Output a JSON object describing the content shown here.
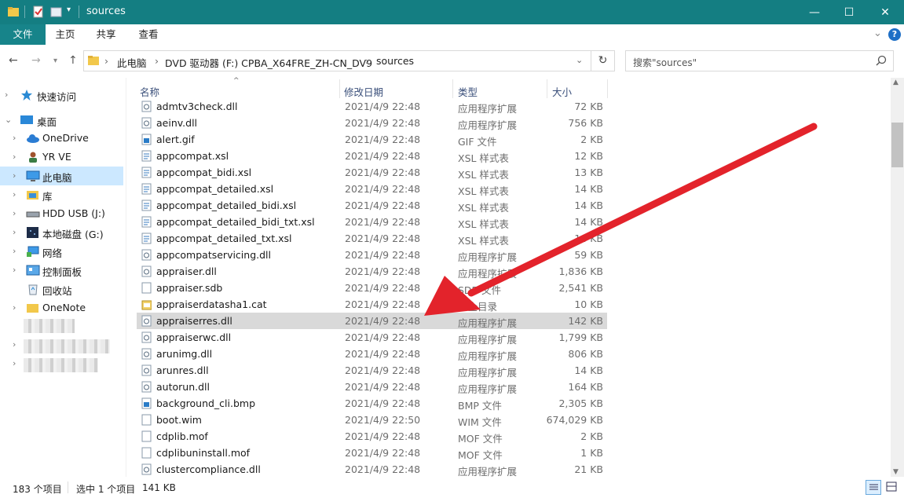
{
  "window": {
    "title": "sources",
    "minimize": "—",
    "maximize": "☐",
    "close": "✕"
  },
  "ribbon": {
    "tabs": [
      "文件",
      "主页",
      "共享",
      "查看"
    ],
    "collapse": "⌄",
    "help": "?"
  },
  "address": {
    "crumbs": [
      "此电脑",
      "DVD 驱动器 (F:) CPBA_X64FRE_ZH-CN_DV9",
      "sources"
    ],
    "search_placeholder": "搜索\"sources\""
  },
  "nav": {
    "items": [
      {
        "label": "快速访问",
        "icon": "star-icon"
      },
      {
        "label": "桌面",
        "icon": "desktop-icon"
      },
      {
        "label": "OneDrive",
        "icon": "cloud-icon"
      },
      {
        "label": "YR VE",
        "icon": "user-icon"
      },
      {
        "label": "此电脑",
        "icon": "computer-icon",
        "selected": true
      },
      {
        "label": "库",
        "icon": "library-icon"
      },
      {
        "label": "HDD USB (J:)",
        "icon": "drive-icon"
      },
      {
        "label": "本地磁盘 (G:)",
        "icon": "disk-icon"
      },
      {
        "label": "网络",
        "icon": "network-icon"
      },
      {
        "label": "控制面板",
        "icon": "control-panel-icon"
      },
      {
        "label": "回收站",
        "icon": "recycle-bin-icon"
      },
      {
        "label": "OneNote",
        "icon": "folder-icon"
      }
    ]
  },
  "columns": {
    "name": "名称",
    "date": "修改日期",
    "type": "类型",
    "size": "大小"
  },
  "files": [
    {
      "name": "admtv3check.dll",
      "date": "2021/4/9 22:48",
      "type": "应用程序扩展",
      "size": "72 KB",
      "icon": "dll"
    },
    {
      "name": "aeinv.dll",
      "date": "2021/4/9 22:48",
      "type": "应用程序扩展",
      "size": "756 KB",
      "icon": "dll"
    },
    {
      "name": "alert.gif",
      "date": "2021/4/9 22:48",
      "type": "GIF 文件",
      "size": "2 KB",
      "icon": "img"
    },
    {
      "name": "appcompat.xsl",
      "date": "2021/4/9 22:48",
      "type": "XSL 样式表",
      "size": "12 KB",
      "icon": "xsl"
    },
    {
      "name": "appcompat_bidi.xsl",
      "date": "2021/4/9 22:48",
      "type": "XSL 样式表",
      "size": "13 KB",
      "icon": "xsl"
    },
    {
      "name": "appcompat_detailed.xsl",
      "date": "2021/4/9 22:48",
      "type": "XSL 样式表",
      "size": "14 KB",
      "icon": "xsl"
    },
    {
      "name": "appcompat_detailed_bidi.xsl",
      "date": "2021/4/9 22:48",
      "type": "XSL 样式表",
      "size": "14 KB",
      "icon": "xsl"
    },
    {
      "name": "appcompat_detailed_bidi_txt.xsl",
      "date": "2021/4/9 22:48",
      "type": "XSL 样式表",
      "size": "14 KB",
      "icon": "xsl"
    },
    {
      "name": "appcompat_detailed_txt.xsl",
      "date": "2021/4/9 22:48",
      "type": "XSL 样式表",
      "size": "14 KB",
      "icon": "xsl"
    },
    {
      "name": "appcompatservicing.dll",
      "date": "2021/4/9 22:48",
      "type": "应用程序扩展",
      "size": "59 KB",
      "icon": "dll"
    },
    {
      "name": "appraiser.dll",
      "date": "2021/4/9 22:48",
      "type": "应用程序扩展",
      "size": "1,836 KB",
      "icon": "dll"
    },
    {
      "name": "appraiser.sdb",
      "date": "2021/4/9 22:48",
      "type": "SDB 文件",
      "size": "2,541 KB",
      "icon": "file"
    },
    {
      "name": "appraiserdatasha1.cat",
      "date": "2021/4/9 22:48",
      "type": "安全目录",
      "size": "10 KB",
      "icon": "cat"
    },
    {
      "name": "appraiserres.dll",
      "date": "2021/4/9 22:48",
      "type": "应用程序扩展",
      "size": "142 KB",
      "icon": "dll",
      "selected": true
    },
    {
      "name": "appraiserwc.dll",
      "date": "2021/4/9 22:48",
      "type": "应用程序扩展",
      "size": "1,799 KB",
      "icon": "dll"
    },
    {
      "name": "arunimg.dll",
      "date": "2021/4/9 22:48",
      "type": "应用程序扩展",
      "size": "806 KB",
      "icon": "dll"
    },
    {
      "name": "arunres.dll",
      "date": "2021/4/9 22:48",
      "type": "应用程序扩展",
      "size": "14 KB",
      "icon": "dll"
    },
    {
      "name": "autorun.dll",
      "date": "2021/4/9 22:48",
      "type": "应用程序扩展",
      "size": "164 KB",
      "icon": "dll"
    },
    {
      "name": "background_cli.bmp",
      "date": "2021/4/9 22:48",
      "type": "BMP 文件",
      "size": "2,305 KB",
      "icon": "img"
    },
    {
      "name": "boot.wim",
      "date": "2021/4/9 22:50",
      "type": "WIM 文件",
      "size": "674,029 KB",
      "icon": "file"
    },
    {
      "name": "cdplib.mof",
      "date": "2021/4/9 22:48",
      "type": "MOF 文件",
      "size": "2 KB",
      "icon": "file"
    },
    {
      "name": "cdplibuninstall.mof",
      "date": "2021/4/9 22:48",
      "type": "MOF 文件",
      "size": "1 KB",
      "icon": "file"
    },
    {
      "name": "clustercompliance.dll",
      "date": "2021/4/9 22:48",
      "type": "应用程序扩展",
      "size": "21 KB",
      "icon": "dll"
    }
  ],
  "status": {
    "count": "183 个项目",
    "selected": "选中 1 个项目",
    "size": "141 KB"
  },
  "colors": {
    "titlebar": "#147e82",
    "selection_nav": "#cce8ff",
    "selection_row": "#d9d9d9",
    "annotation_arrow": "#e3232b"
  }
}
